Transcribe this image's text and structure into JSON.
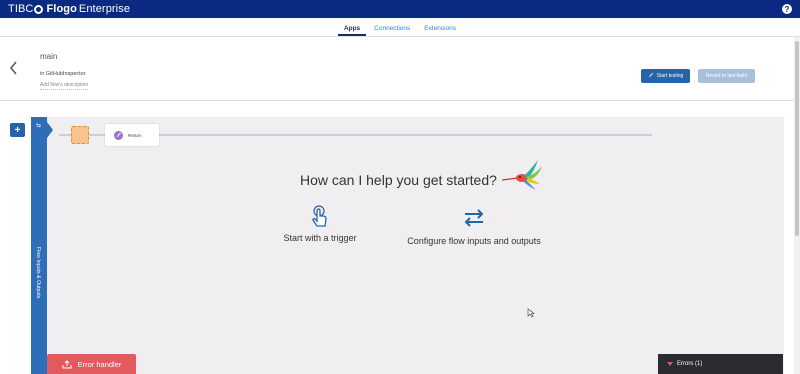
{
  "app": {
    "brand_prefix": "TIBC",
    "brand_product": "Flogo",
    "brand_suffix": "Enterprise",
    "help_glyph": "?"
  },
  "tabs": [
    {
      "label": "Apps",
      "active": true
    },
    {
      "label": "Connections",
      "active": false
    },
    {
      "label": "Extensions",
      "active": false
    }
  ],
  "flow": {
    "name": "main",
    "app_line": "in GitHubInspector",
    "description_placeholder": "Add flow's description",
    "start_testing_label": "Start testing",
    "revert_label": "Revert to last build"
  },
  "canvas": {
    "add_glyph": "+",
    "io_label": "Flow Inputs & Outputs",
    "io_arrows": "⇆",
    "return_label": "Return",
    "help_title": "How can I help you get started?",
    "options": {
      "trigger_label": "Start with a trigger",
      "io_label": "Configure flow inputs and outputs"
    },
    "error_handler_label": "Error handler",
    "errors_label": "Errors (1)"
  },
  "colors": {
    "topbar": "#0a2a82",
    "primary": "#2563aa",
    "canvas_bg": "#f1eef1",
    "error": "#e35a5e"
  },
  "icons": [
    "tibco-logo-icon",
    "help-icon",
    "back-arrow-icon",
    "rocket-icon",
    "plus-icon",
    "swap-arrows-icon",
    "return-icon",
    "hummingbird-icon",
    "tap-hand-icon",
    "exchange-icon",
    "export-icon",
    "caret-down-icon",
    "mouse-cursor-icon"
  ]
}
